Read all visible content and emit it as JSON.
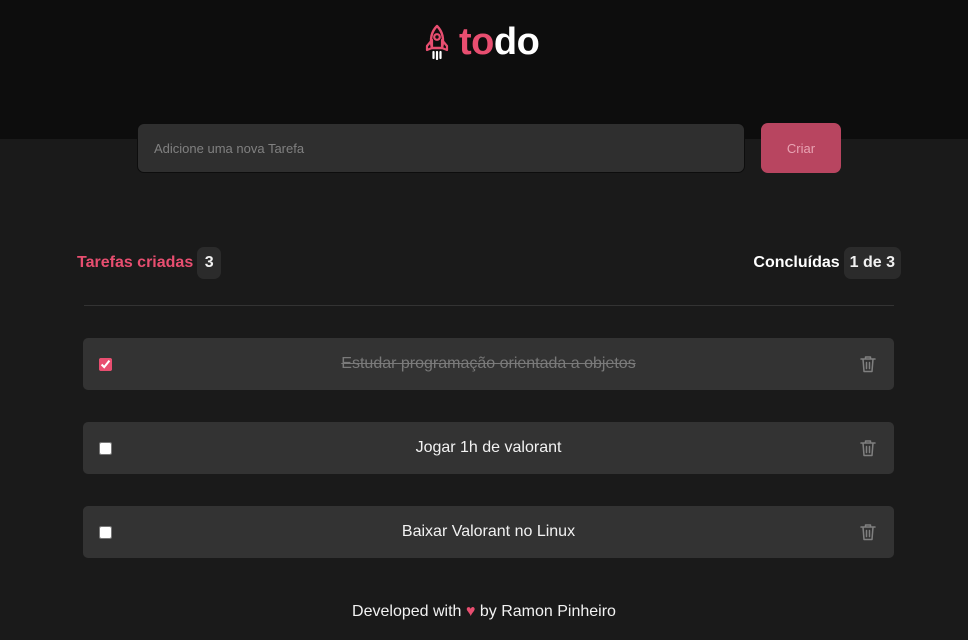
{
  "header": {
    "logo_icon": "rocket-icon",
    "logo_part1": "to",
    "logo_part2": "do"
  },
  "new_task": {
    "placeholder": "Adicione uma nova Tarefa",
    "value": "",
    "button_label": "Criar"
  },
  "stats": {
    "created_label": "Tarefas criadas",
    "created_count": "3",
    "done_label": "Concluídas",
    "done_count": "1 de 3"
  },
  "tasks": [
    {
      "text": "Estudar programação orientada a objetos",
      "done": true,
      "delete_icon": "trash-icon"
    },
    {
      "text": "Jogar 1h de valorant",
      "done": false,
      "delete_icon": "trash-icon"
    },
    {
      "text": "Baixar Valorant no Linux",
      "done": false,
      "delete_icon": "trash-icon"
    }
  ],
  "footer": {
    "prefix": "Developed with",
    "heart": "♥",
    "suffix": "by Ramon Pinheiro"
  },
  "colors": {
    "accent": "#e84e70",
    "header_bg": "#0d0d0d",
    "body_bg": "#1a1a1a",
    "card_bg": "#333333"
  }
}
